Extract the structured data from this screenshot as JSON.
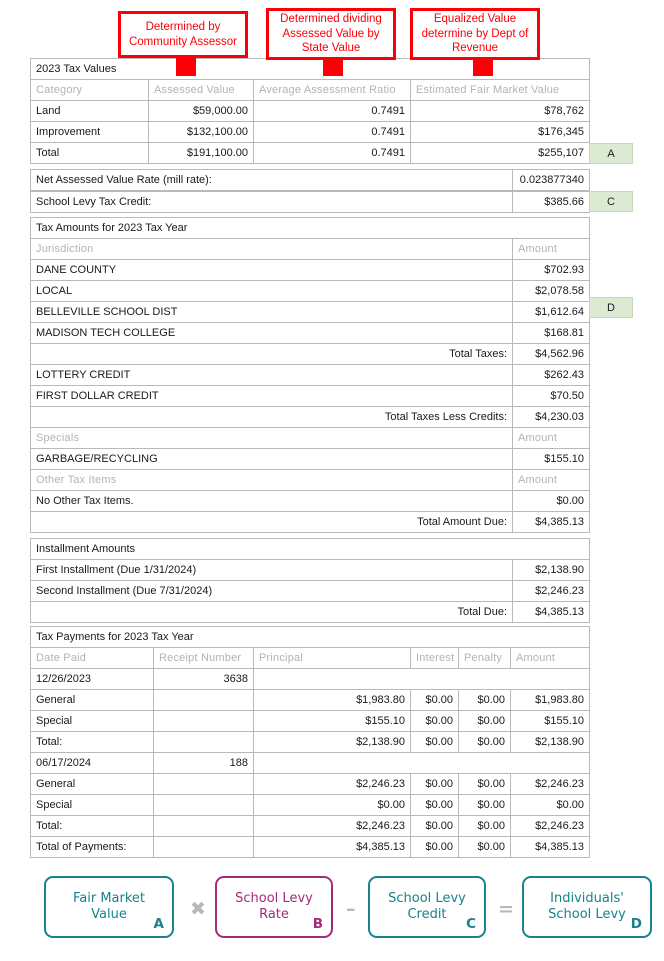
{
  "callouts": [
    {
      "id": "callout-community-assessor",
      "text": "Determined by Community Assessor"
    },
    {
      "id": "callout-assessment-ratio",
      "text": "Determined dividing Assessed Value by State Value"
    },
    {
      "id": "callout-equalized-value",
      "text": "Equalized Value determine by Dept of Revenue"
    }
  ],
  "tax_values": {
    "section_title": "2023 Tax Values",
    "columns": [
      "Category",
      "Assessed Value",
      "Average Assessment Ratio",
      "Estimated Fair Market Value"
    ],
    "rows": [
      {
        "category": "Land",
        "assessed": "$59,000.00",
        "ratio": "0.7491",
        "fmv": "$78,762"
      },
      {
        "category": "Improvement",
        "assessed": "$132,100.00",
        "ratio": "0.7491",
        "fmv": "$176,345"
      },
      {
        "category": "Total",
        "assessed": "$191,100.00",
        "ratio": "0.7491",
        "fmv": "$255,107"
      }
    ],
    "badge_a": "A"
  },
  "rates": {
    "mill_rate_label": "Net Assessed Value Rate (mill rate):",
    "mill_rate_value": "0.023877340",
    "school_levy_credit_label": "School Levy Tax Credit:",
    "school_levy_credit_value": "$385.66",
    "badge_c": "C"
  },
  "tax_amounts": {
    "section_title": "Tax Amounts for 2023 Tax Year",
    "columns": [
      "Jurisdiction",
      "Amount"
    ],
    "jurisdictions": [
      {
        "name": "DANE COUNTY",
        "amount": "$702.93"
      },
      {
        "name": "LOCAL",
        "amount": "$2,078.58"
      },
      {
        "name": "BELLEVILLE SCHOOL DIST",
        "amount": "$1,612.64"
      },
      {
        "name": "MADISON TECH COLLEGE",
        "amount": "$168.81"
      }
    ],
    "badge_d": "D",
    "total_taxes_label": "Total Taxes:",
    "total_taxes_value": "$4,562.96",
    "credits": [
      {
        "name": "LOTTERY CREDIT",
        "amount": "$262.43"
      },
      {
        "name": "FIRST DOLLAR CREDIT",
        "amount": "$70.50"
      }
    ],
    "total_less_credits_label": "Total Taxes Less Credits:",
    "total_less_credits_value": "$4,230.03",
    "specials_header": [
      "Specials",
      "Amount"
    ],
    "specials": [
      {
        "name": "GARBAGE/RECYCLING",
        "amount": "$155.10"
      }
    ],
    "other_header": [
      "Other Tax Items",
      "Amount"
    ],
    "other_items": [
      {
        "name": "No Other Tax Items.",
        "amount": "$0.00"
      }
    ],
    "total_due_label": "Total Amount Due:",
    "total_due_value": "$4,385.13"
  },
  "installments": {
    "section_title": "Installment Amounts",
    "rows": [
      {
        "label": "First Installment (Due 1/31/2024)",
        "amount": "$2,138.90"
      },
      {
        "label": "Second Installment (Due 7/31/2024)",
        "amount": "$2,246.23"
      }
    ],
    "total_label": "Total Due:",
    "total_value": "$4,385.13"
  },
  "payments": {
    "section_title": "Tax Payments for 2023 Tax Year",
    "columns": [
      "Date Paid",
      "Receipt Number",
      "Principal",
      "Interest",
      "Penalty",
      "Amount"
    ],
    "groups": [
      {
        "date": "12/26/2023",
        "receipt": "3638",
        "lines": [
          {
            "label": "General",
            "principal": "$1,983.80",
            "interest": "$0.00",
            "penalty": "$0.00",
            "amount": "$1,983.80"
          },
          {
            "label": "Special",
            "principal": "$155.10",
            "interest": "$0.00",
            "penalty": "$0.00",
            "amount": "$155.10"
          },
          {
            "label": "Total:",
            "principal": "$2,138.90",
            "interest": "$0.00",
            "penalty": "$0.00",
            "amount": "$2,138.90"
          }
        ]
      },
      {
        "date": "06/17/2024",
        "receipt": "188",
        "lines": [
          {
            "label": "General",
            "principal": "$2,246.23",
            "interest": "$0.00",
            "penalty": "$0.00",
            "amount": "$2,246.23"
          },
          {
            "label": "Special",
            "principal": "$0.00",
            "interest": "$0.00",
            "penalty": "$0.00",
            "amount": "$0.00"
          },
          {
            "label": "Total:",
            "principal": "$2,246.23",
            "interest": "$0.00",
            "penalty": "$0.00",
            "amount": "$2,246.23"
          }
        ]
      }
    ],
    "total_row": {
      "label": "Total of Payments:",
      "principal": "$4,385.13",
      "interest": "$0.00",
      "penalty": "$0.00",
      "amount": "$4,385.13"
    }
  },
  "formula": {
    "boxes": [
      {
        "line1": "Fair Market",
        "line2": "Value",
        "letter": "A",
        "color": "#17838c"
      },
      {
        "line1": "School Levy",
        "line2": "Rate",
        "letter": "B",
        "color": "#a52a7d"
      },
      {
        "line1": "School Levy",
        "line2": "Credit",
        "letter": "C",
        "color": "#17838c"
      },
      {
        "line1": "Individuals'",
        "line2": "School Levy",
        "letter": "D",
        "color": "#17838c"
      }
    ],
    "operators": [
      "✖",
      "–",
      "="
    ]
  },
  "colors": {
    "annotation_red": "#fb0007",
    "badge_green": "#dce9d3",
    "teal": "#17838c",
    "magenta": "#a52a7d",
    "operator_gray": "#b8b8b8"
  }
}
